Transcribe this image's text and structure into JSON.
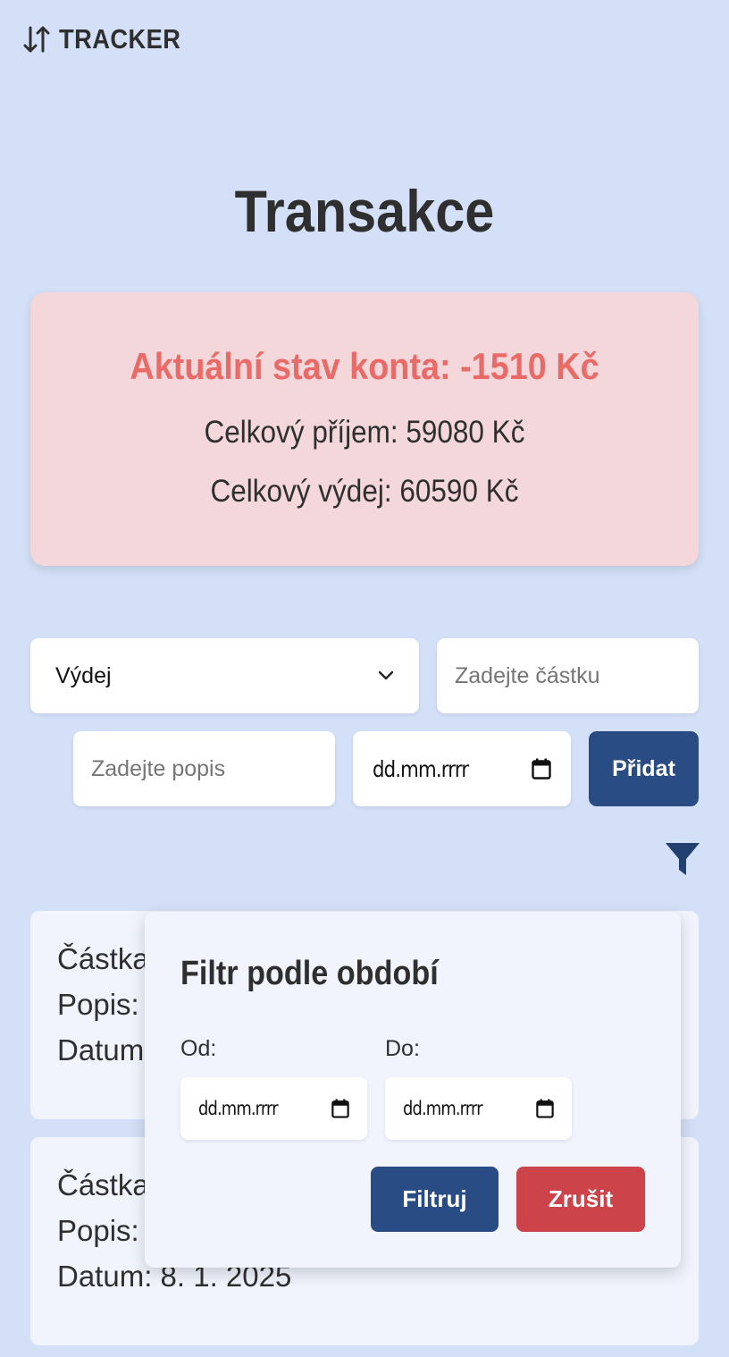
{
  "header": {
    "brand": "TRACKER",
    "brand_icon": "swap-vertical-icon"
  },
  "page": {
    "title": "Transakce"
  },
  "summary": {
    "balance": "Aktuální stav konta: -1510 Kč",
    "income": "Celkový příjem: 59080 Kč",
    "expense": "Celkový výdej: 60590 Kč",
    "balance_color": "#ea6a67",
    "card_color": "#f4d7da"
  },
  "form": {
    "type_value": "Výdej",
    "amount_placeholder": "Zadejte částku",
    "description_placeholder": "Zadejte popis",
    "date_placeholder": "dd.mm.rrrr",
    "add_label": "Přidat"
  },
  "transactions": [
    {
      "amount": "Částka:",
      "description": "Popis: v",
      "date": "Datum:"
    },
    {
      "amount": "Částka:",
      "description": "Popis: l",
      "date": "Datum: 8. 1. 2025"
    }
  ],
  "filter": {
    "title": "Filtr podle období",
    "from_label": "Od:",
    "to_label": "Do:",
    "from_placeholder": "dd.mm.rrrr",
    "to_placeholder": "dd.mm.rrrr",
    "apply_label": "Filtruj",
    "cancel_label": "Zrušit",
    "apply_color": "#294c85",
    "cancel_color": "#cd434a"
  }
}
